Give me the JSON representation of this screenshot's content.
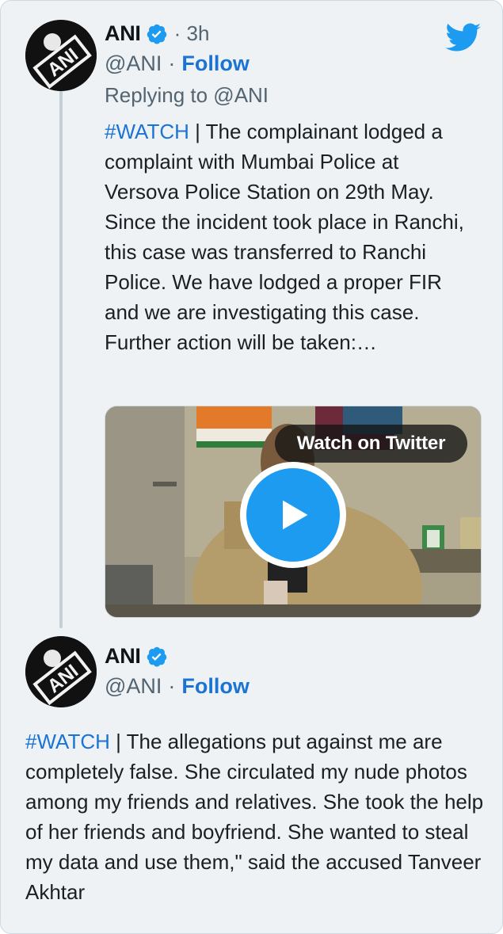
{
  "tweets": [
    {
      "name": "ANI",
      "time": "3h",
      "handle": "@ANI",
      "follow_label": "Follow",
      "replying_to": "Replying to @ANI",
      "hashtag": "#WATCH",
      "text": " | The complainant lodged a complaint with Mumbai Police at Versova Police Station on 29th May. Since the incident took place in Ranchi, this case was transferred to Ranchi Police. We have lodged a proper FIR and we are investigating this case. Further action will be taken:…",
      "media": {
        "watch_label": "Watch on Twitter",
        "play_icon": "play-icon"
      }
    },
    {
      "name": "ANI",
      "handle": "@ANI",
      "follow_label": "Follow",
      "hashtag": "#WATCH",
      "text": " | The allegations put against me are completely false. She circulated my nude photos among my friends and relatives. She took the help of her friends and boyfriend. She wanted to steal my data and use them,\" said the accused Tanveer Akhtar"
    }
  ],
  "avatar_text": "ANI",
  "colors": {
    "link": "#1b74d4",
    "verified": "#1d9bf0",
    "twitter": "#1d9bf0",
    "card_bg": "#eef2f5",
    "muted": "#536471"
  },
  "icons": [
    "verified-badge-icon",
    "twitter-bird-icon",
    "play-icon"
  ]
}
